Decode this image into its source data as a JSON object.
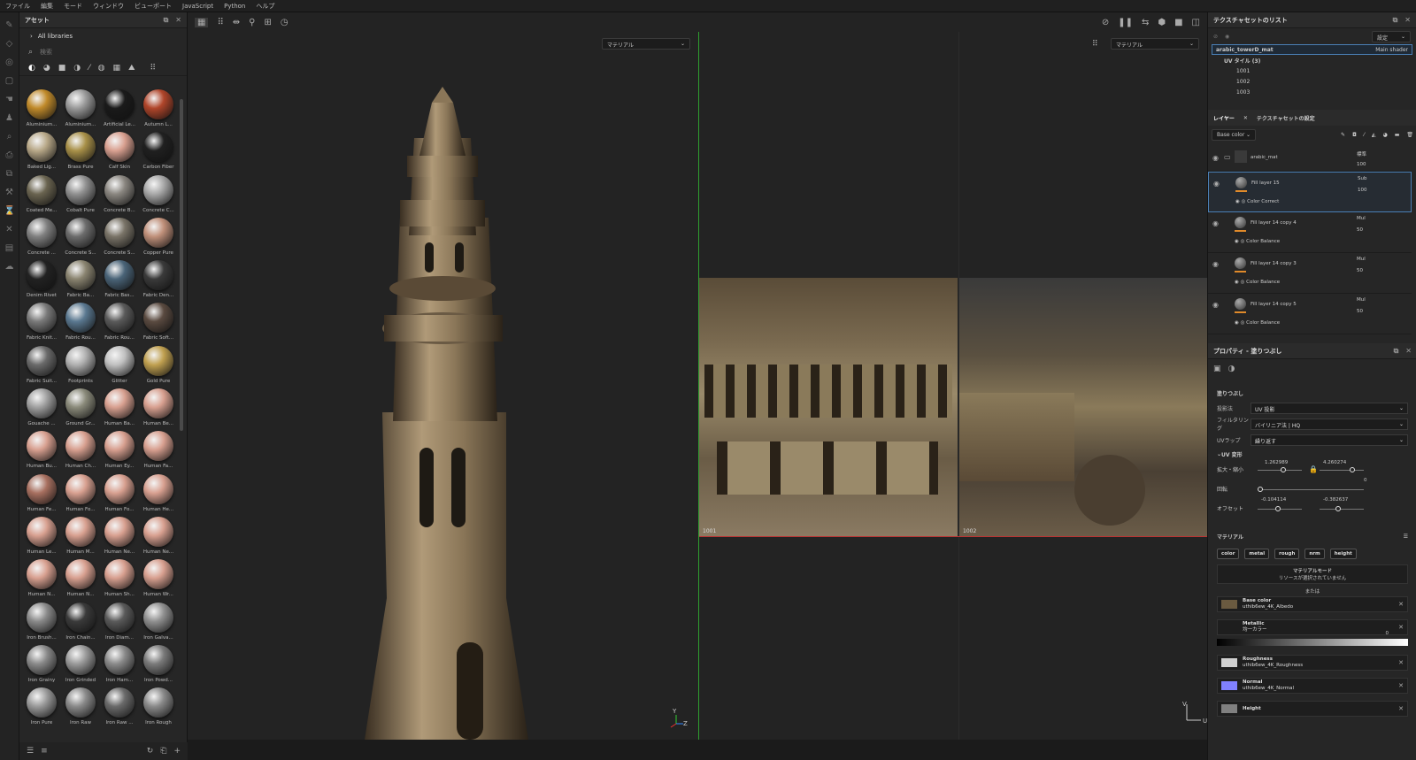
{
  "menu": [
    "ファイル",
    "編集",
    "モード",
    "ウィンドウ",
    "ビューポート",
    "JavaScript",
    "Python",
    "ヘルプ"
  ],
  "assets": {
    "title": "アセット",
    "library": "All libraries",
    "search_placeholder": "検索",
    "materials": [
      {
        "name": "Aluminium...",
        "color": "#c08a2a"
      },
      {
        "name": "Aluminium...",
        "color": "#9a9a9a"
      },
      {
        "name": "Artificial Le...",
        "color": "#1a1a1a"
      },
      {
        "name": "Autumn L...",
        "color": "#b0452a"
      },
      {
        "name": "Baked Lig...",
        "color": "#b8a888"
      },
      {
        "name": "Brass Pure",
        "color": "#a89048"
      },
      {
        "name": "Calf Skin",
        "color": "#d9a090"
      },
      {
        "name": "Carbon Fiber",
        "color": "#202020"
      },
      {
        "name": "Coated Me...",
        "color": "#6a6450"
      },
      {
        "name": "Cobalt Pure",
        "color": "#909090"
      },
      {
        "name": "Concrete B...",
        "color": "#8a8680"
      },
      {
        "name": "Concrete C...",
        "color": "#a8a8a8"
      },
      {
        "name": "Concrete ...",
        "color": "#808080"
      },
      {
        "name": "Concrete S...",
        "color": "#6c6c6c"
      },
      {
        "name": "Concrete S...",
        "color": "#7a7468"
      },
      {
        "name": "Copper Pure",
        "color": "#c0907a"
      },
      {
        "name": "Denim Rivet",
        "color": "#222222"
      },
      {
        "name": "Fabric Ba...",
        "color": "#8a8470"
      },
      {
        "name": "Fabric Bas...",
        "color": "#4a6478"
      },
      {
        "name": "Fabric Den...",
        "color": "#3a3a3a"
      },
      {
        "name": "Fabric Knit...",
        "color": "#7a7a7a"
      },
      {
        "name": "Fabric Rou...",
        "color": "#5a7890"
      },
      {
        "name": "Fabric Rou...",
        "color": "#5a5a5a"
      },
      {
        "name": "Fabric Soft...",
        "color": "#5a4a40"
      },
      {
        "name": "Fabric Suit...",
        "color": "#6a6a6a"
      },
      {
        "name": "Footprints",
        "color": "#b0b0b0"
      },
      {
        "name": "Glitter",
        "color": "#c0c0c0"
      },
      {
        "name": "Gold Pure",
        "color": "#c0a050"
      },
      {
        "name": "Gouache ...",
        "color": "#a0a0a0"
      },
      {
        "name": "Ground Gr...",
        "color": "#8a8a7a"
      },
      {
        "name": "Human Ba...",
        "color": "#d8a090"
      },
      {
        "name": "Human Be...",
        "color": "#d8a090"
      },
      {
        "name": "Human Bu...",
        "color": "#d8a090"
      },
      {
        "name": "Human Ch...",
        "color": "#d8a090"
      },
      {
        "name": "Human Ey...",
        "color": "#d8a090"
      },
      {
        "name": "Human Fa...",
        "color": "#d8a090"
      },
      {
        "name": "Human Fe...",
        "color": "#a87060"
      },
      {
        "name": "Human Fo...",
        "color": "#d8a090"
      },
      {
        "name": "Human Fo...",
        "color": "#d8a090"
      },
      {
        "name": "Human He...",
        "color": "#d8a090"
      },
      {
        "name": "Human Le...",
        "color": "#d8a090"
      },
      {
        "name": "Human M...",
        "color": "#d8a090"
      },
      {
        "name": "Human Ne...",
        "color": "#d8a090"
      },
      {
        "name": "Human Ne...",
        "color": "#d8a090"
      },
      {
        "name": "Human N...",
        "color": "#d8a090"
      },
      {
        "name": "Human N...",
        "color": "#d8a090"
      },
      {
        "name": "Human Sh...",
        "color": "#d8a090"
      },
      {
        "name": "Human Wr...",
        "color": "#d8a090"
      },
      {
        "name": "Iron Brush...",
        "color": "#8a8a8a"
      },
      {
        "name": "Iron Chain...",
        "color": "#3a3a3a"
      },
      {
        "name": "Iron Diam...",
        "color": "#5a5a5a"
      },
      {
        "name": "Iron Galva...",
        "color": "#909090"
      },
      {
        "name": "Iron Grainy",
        "color": "#8a8a8a"
      },
      {
        "name": "Iron Grinded",
        "color": "#9a9a9a"
      },
      {
        "name": "Iron Ham...",
        "color": "#8a8a8a"
      },
      {
        "name": "Iron Powd...",
        "color": "#7a7a7a"
      },
      {
        "name": "Iron Pure",
        "color": "#9a9a9a"
      },
      {
        "name": "Iron Raw",
        "color": "#8a8a8a"
      },
      {
        "name": "Iron Raw ...",
        "color": "#6a6a6a"
      },
      {
        "name": "Iron Rough",
        "color": "#8a8a8a"
      }
    ]
  },
  "viewport": {
    "dropdown3d": "マテリアル",
    "dropdown2d": "マテリアル",
    "uv_tile_1": "1001",
    "uv_tile_2": "1002"
  },
  "textureset": {
    "title": "テクスチャセットのリスト",
    "settings_label": "設定",
    "set_name": "arabic_towerD_mat",
    "shader": "Main shader",
    "uv_tiles_label": "UV タイル (3)",
    "tiles": [
      "1001",
      "1002",
      "1003"
    ]
  },
  "layers": {
    "tab_layers": "レイヤー",
    "tab_settings": "テクスチャセットの設定",
    "channel": "Base color",
    "items": [
      {
        "name": "arabic_mat",
        "blend": "標準",
        "opacity": "100",
        "sub": "",
        "color": "#ccc"
      },
      {
        "name": "Fill layer 15",
        "blend": "Sub",
        "opacity": "100",
        "sub": "Color Correct",
        "color": "#e08a2a"
      },
      {
        "name": "Fill layer 14 copy 4",
        "blend": "Mul",
        "opacity": "50",
        "sub": "Color Balance",
        "color": "#e08a2a"
      },
      {
        "name": "Fill layer 14 copy 3",
        "blend": "Mul",
        "opacity": "50",
        "sub": "Color Balance",
        "color": "#e08a2a"
      },
      {
        "name": "Fill layer 14 copy 5",
        "blend": "Mul",
        "opacity": "50",
        "sub": "Color Balance",
        "color": "#e08a2a"
      }
    ]
  },
  "properties": {
    "title": "プロパティ - 塗りつぶし",
    "section": "塗りつぶし",
    "projection_label": "投影法",
    "projection_value": "UV 投影",
    "filter_label": "フィルタリング",
    "filter_value": "バイリニア法 | HQ",
    "wrap_label": "UVラップ",
    "wrap_value": "繰り返す",
    "uv_transform": "UV 変形",
    "scale_label": "拡大・縮小",
    "scale_x": "1.262989",
    "scale_y": "4.260274",
    "rotation_label": "回転",
    "rotation_value": "0",
    "offset_label": "オフセット",
    "offset_x": "-0.104114",
    "offset_y": "-0.382637",
    "material_label": "マテリアル",
    "channels": [
      "color",
      "metal",
      "rough",
      "nrm",
      "height"
    ],
    "mode_label": "マテリアルモード",
    "mode_value": "リソースが選択されていません",
    "or_label": "または",
    "slots": [
      {
        "name": "Base color",
        "file": "uthib6ew_4K_Albedo",
        "swatch": "#6a5a40"
      },
      {
        "name": "Metallic",
        "file": "均一カラー",
        "swatch": ""
      },
      {
        "name": "Roughness",
        "file": "uthib6ew_4K_Roughness",
        "swatch": "#d0d0d0"
      },
      {
        "name": "Normal",
        "file": "uthib6ew_4K_Normal",
        "swatch": "#8080ff"
      },
      {
        "name": "Height",
        "file": "",
        "swatch": "#808080"
      }
    ],
    "metallic_value": "0"
  }
}
